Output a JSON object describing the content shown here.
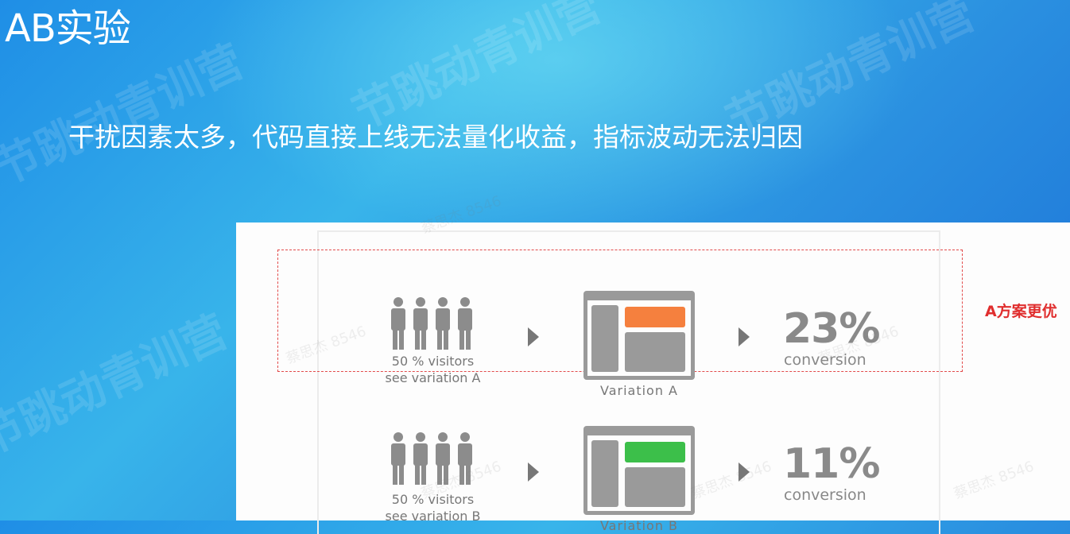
{
  "title": "AB实验",
  "subtitle": "干扰因素太多，代码直接上线无法量化收益，指标波动无法归因",
  "note": "A方案更优",
  "variations": [
    {
      "visitors_line1": "50 % visitors",
      "visitors_line2": "see variation A",
      "label": "Variation A",
      "percent": "23%",
      "conversion_label": "conversion",
      "highlight_color": "#f5803e"
    },
    {
      "visitors_line1": "50 % visitors",
      "visitors_line2": "see variation B",
      "label": "Variation B",
      "percent": "11%",
      "conversion_label": "conversion",
      "highlight_color": "#3cbf4a"
    }
  ],
  "colors": {
    "background": "#2a9be6",
    "note": "#e02e2e",
    "dashed_border": "#e24a4a",
    "icon_gray": "#8c8c8c"
  },
  "icons": [
    "person-icon",
    "arrow-right-icon",
    "browser-layout-icon"
  ]
}
